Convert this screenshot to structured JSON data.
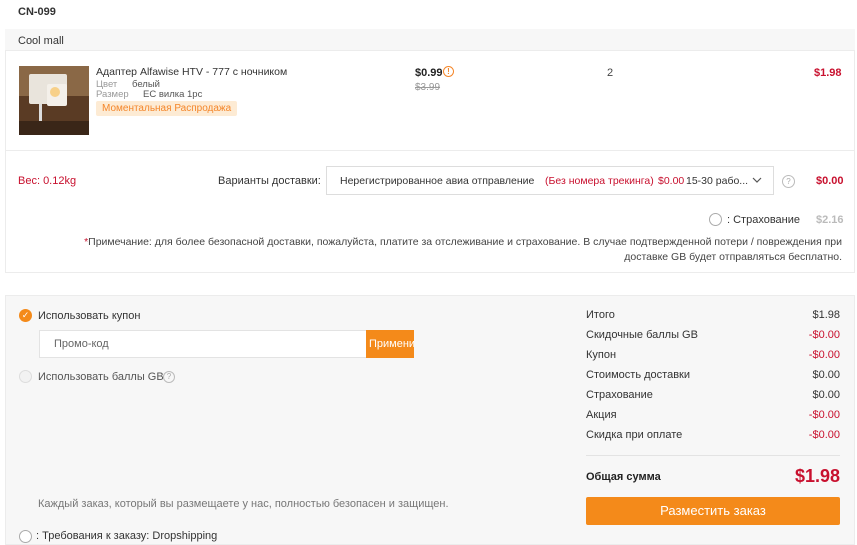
{
  "warehouse": "CN-099",
  "store": {
    "name": "Cool mall"
  },
  "product": {
    "title": "Адаптер Alfawise HTV - 777 с ночником",
    "attrs": [
      {
        "label": "Цвет",
        "value": "белый"
      },
      {
        "label": "Размер",
        "value": "EC вилка 1pc"
      }
    ],
    "badge": "Моментальная Распродажа",
    "price": "$0.99",
    "old_price": "$3.99",
    "quantity": "2",
    "line_total": "$1.98"
  },
  "shipping": {
    "weight": "Вес: 0.12kg",
    "label": "Варианты доставки:",
    "method": "Нерегистрированное авиа отправление",
    "no_tracking": "(Без номера трекинга)",
    "price": "$0.00",
    "days": "15-30 рабо...",
    "cost": "$0.00",
    "insurance_label": ": Страхование",
    "insurance_cost": "$2.16",
    "note_star": "*",
    "note": "Примечание: для более безопасной доставки, пожалуйста, платите за отслеживание и страхование. В случае подтвержденной потери / повреждения при доставке GB будет отправляться бесплатно."
  },
  "checkout": {
    "coupon_label": "Использовать купон",
    "promo_placeholder": "Промо-код",
    "apply_label": "Применить",
    "gb_points_label": "Использовать баллы GB",
    "secure_text": "Каждый заказ, который вы размещаете у нас, полностью безопасен и защищен.",
    "dropship_label": ": Требования к заказу: Dropshipping"
  },
  "summary": {
    "items": [
      {
        "label": "Итого",
        "value": "$1.98",
        "negative": false
      },
      {
        "label": "Скидочные баллы GB",
        "value": "-$0.00",
        "negative": true
      },
      {
        "label": "Купон",
        "value": "-$0.00",
        "negative": true
      },
      {
        "label": "Стоимость доставки",
        "value": "$0.00",
        "negative": false
      },
      {
        "label": "Страхование",
        "value": "$0.00",
        "negative": false
      },
      {
        "label": "Акция",
        "value": "-$0.00",
        "negative": true
      },
      {
        "label": "Скидка при оплате",
        "value": "-$0.00",
        "negative": true
      }
    ],
    "total_label": "Общая сумма",
    "total_value": "$1.98",
    "place_order_label": "Разместить заказ"
  },
  "colors": {
    "accent": "#f48a1a",
    "price_red": "#c8102e"
  },
  "icons": [
    "info-icon",
    "chevron-down-icon",
    "help-icon",
    "check-icon"
  ]
}
